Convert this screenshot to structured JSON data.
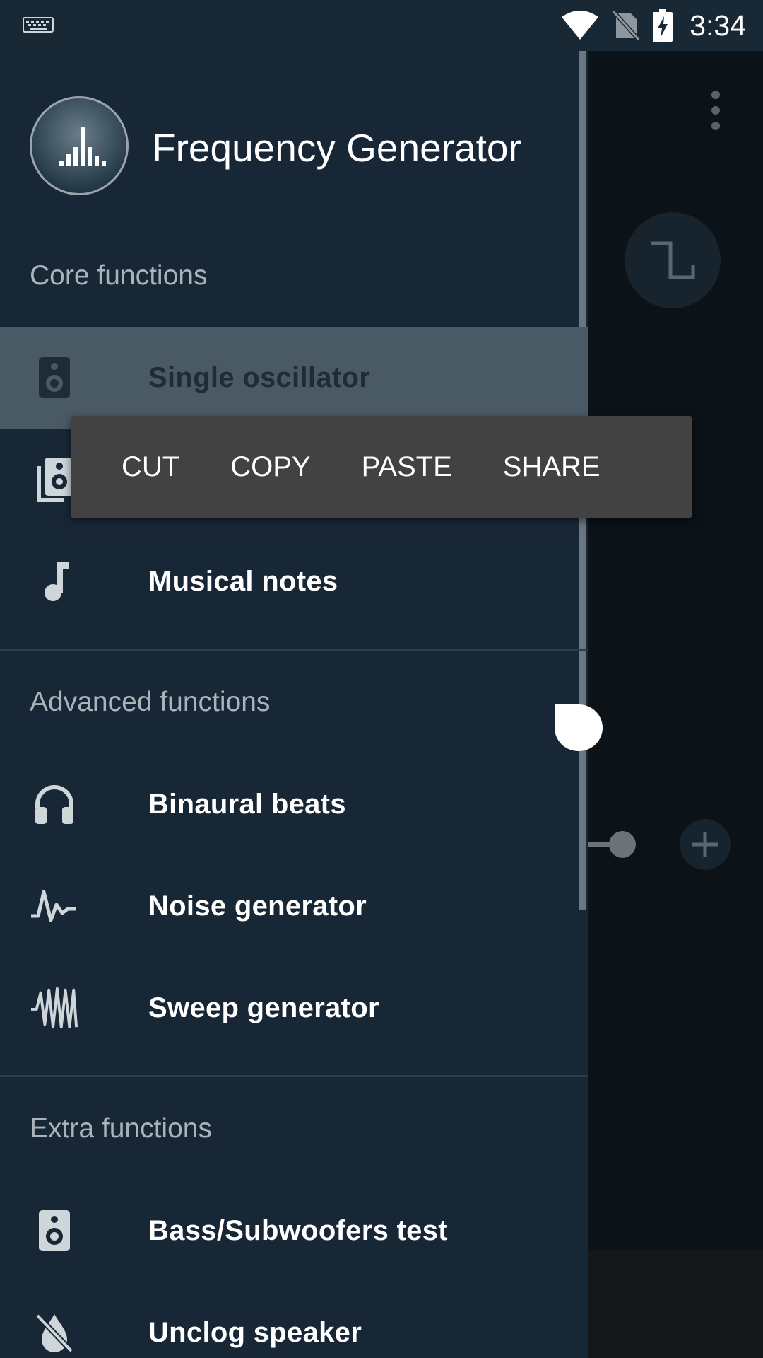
{
  "status_bar": {
    "time": "3:34",
    "icons": [
      "keyboard-icon",
      "wifi-icon",
      "no-sim-icon",
      "battery-charging-icon"
    ]
  },
  "drawer": {
    "app_title": "Frequency Generator",
    "sections": [
      {
        "title": "Core functions",
        "items": [
          {
            "label": "Single oscillator",
            "icon": "speaker-icon",
            "selected": true
          },
          {
            "label": "",
            "icon": "speakers-stack-icon"
          },
          {
            "label": "Musical notes",
            "icon": "music-note-icon"
          }
        ]
      },
      {
        "title": "Advanced functions",
        "items": [
          {
            "label": "Binaural beats",
            "icon": "headphones-icon"
          },
          {
            "label": "Noise generator",
            "icon": "noise-wave-icon"
          },
          {
            "label": "Sweep generator",
            "icon": "sweep-wave-icon"
          }
        ]
      },
      {
        "title": "Extra functions",
        "items": [
          {
            "label": "Bass/Subwoofers test",
            "icon": "speaker-icon"
          },
          {
            "label": "Unclog speaker",
            "icon": "water-drop-off-icon"
          }
        ]
      }
    ]
  },
  "text_popup": {
    "cut": "CUT",
    "copy": "COPY",
    "paste": "PASTE",
    "share": "SHARE"
  },
  "colors": {
    "drawer_bg": "#182736",
    "status_bar_bg": "#182835",
    "selected_item_bg": "#4a5a65",
    "popup_bg": "#424242",
    "section_title": "#a9b3b9"
  }
}
